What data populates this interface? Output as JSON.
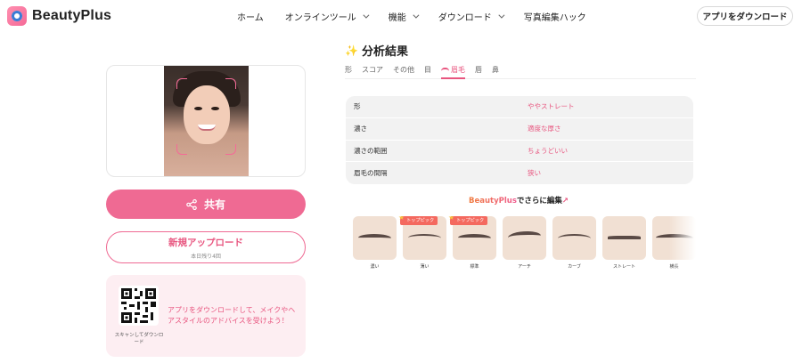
{
  "brand": {
    "name": "BeautyPlus",
    "accent": "#ef6a93"
  },
  "nav": {
    "items": [
      {
        "label": "ホーム",
        "dropdown": false
      },
      {
        "label": "オンラインツール",
        "dropdown": true
      },
      {
        "label": "機能",
        "dropdown": true
      },
      {
        "label": "ダウンロード",
        "dropdown": true
      },
      {
        "label": "写真編集ハック",
        "dropdown": false
      }
    ],
    "download_app": "アプリをダウンロード"
  },
  "left": {
    "share_label": "共有",
    "upload_label": "新規アップロード",
    "upload_sub": "本日残り4回",
    "qr_caption": "スキャンしてダウンロード",
    "promo_text": "アプリをダウンロードして、メイクやヘアスタイルのアドバイスを受けよう！"
  },
  "analysis": {
    "title": "分析結果",
    "tabs": [
      "形",
      "スコア",
      "その他",
      "目",
      "眉毛",
      "唇",
      "鼻"
    ],
    "active_tab": "眉毛",
    "rows": [
      {
        "label": "形",
        "value": "ややストレート"
      },
      {
        "label": "濃さ",
        "value": "適度な厚さ"
      },
      {
        "label": "濃さの範囲",
        "value": "ちょうどいい"
      },
      {
        "label": "眉毛の間隔",
        "value": "狭い"
      }
    ]
  },
  "edit": {
    "brand": "BeautyPlus",
    "suffix": "でさらに編集",
    "arrow": "↗",
    "styles": [
      {
        "label": "濃い",
        "badge": ""
      },
      {
        "label": "薄い",
        "badge": "トップピック"
      },
      {
        "label": "標準",
        "badge": "トップピック"
      },
      {
        "label": "アーチ",
        "badge": ""
      },
      {
        "label": "カーブ",
        "badge": ""
      },
      {
        "label": "ストレート",
        "badge": ""
      },
      {
        "label": "横長",
        "badge": ""
      }
    ]
  }
}
